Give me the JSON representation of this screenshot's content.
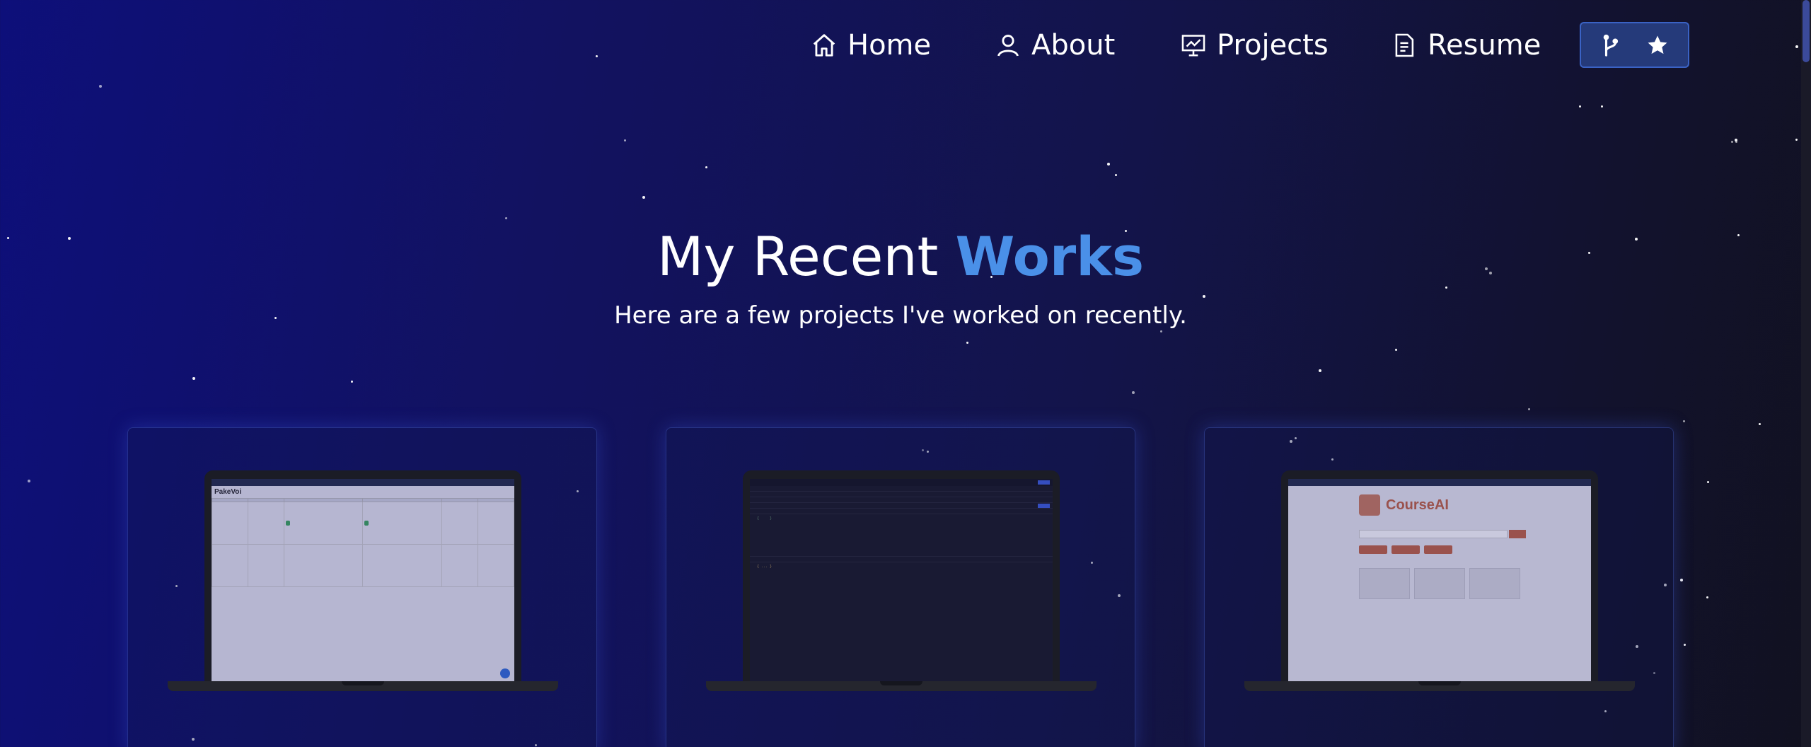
{
  "nav": {
    "items": [
      {
        "label": "Home",
        "icon": "home-icon"
      },
      {
        "label": "About",
        "icon": "user-icon"
      },
      {
        "label": "Projects",
        "icon": "presentation-icon"
      },
      {
        "label": "Resume",
        "icon": "document-icon"
      }
    ],
    "github_button": {
      "icons": [
        "fork-icon",
        "star-icon"
      ]
    }
  },
  "hero": {
    "title_prefix": "My Recent ",
    "title_accent": "Works",
    "subtitle": "Here are a few projects I've worked on recently."
  },
  "colors": {
    "accent": "#4a90e8",
    "button_bg": "#253a7a",
    "button_border": "#3a62c4",
    "background_start": "#0d0f7a",
    "background_end": "#111120"
  },
  "projects": [
    {
      "screenshot_title": "PakeVoi"
    },
    {
      "screenshot_title": ""
    },
    {
      "screenshot_title": "CourseAI"
    }
  ]
}
